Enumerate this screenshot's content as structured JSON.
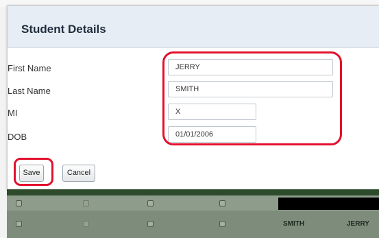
{
  "dialog": {
    "title": "Student Details",
    "fields": [
      {
        "label": "First Name",
        "value": "JERRY"
      },
      {
        "label": "Last Name",
        "value": "SMITH"
      },
      {
        "label": "MI",
        "value": "X"
      },
      {
        "label": "DOB",
        "value": "01/01/2006"
      }
    ],
    "buttons": {
      "save_label": "Save",
      "cancel_label": "Cancel"
    }
  },
  "grid": {
    "rows": [
      {
        "last_name": "",
        "first_name": ""
      },
      {
        "last_name": "SMITH",
        "first_name": "JERRY"
      }
    ]
  },
  "colors": {
    "highlight": "#e3102c",
    "dialog_header": "#e6edf4",
    "grid_header": "#2d4a2a",
    "grid_row": "#8e9c8c"
  }
}
